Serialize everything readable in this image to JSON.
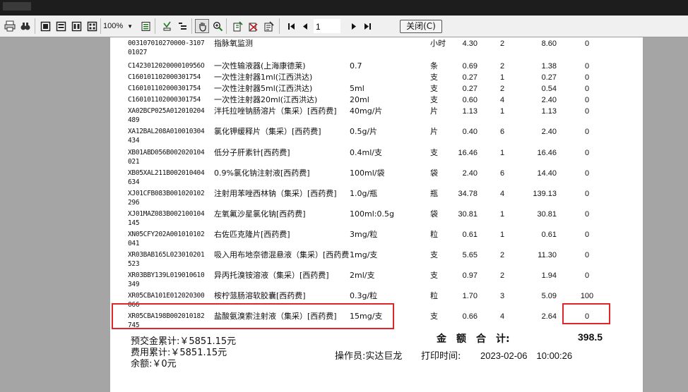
{
  "toolbar": {
    "zoom": "100%",
    "page": "1",
    "close_label": "关闭(C)"
  },
  "rows": [
    {
      "code": "003107010270000-3107",
      "code2": "01027",
      "name": "指脉氧监测",
      "spec": "",
      "unit": "小时",
      "price": "4.30",
      "qty": "2",
      "amount": "8.60",
      "last": "0"
    },
    {
      "code": "C142301202000010956O",
      "code2": "",
      "name": "一次性输液器(上海康德莱)",
      "spec": "0.7",
      "unit": "条",
      "price": "0.69",
      "qty": "2",
      "amount": "1.38",
      "last": "0"
    },
    {
      "code": "C160101102000301754",
      "code2": "",
      "name": "一次性注射器1ml(江西洪达)",
      "spec": "",
      "unit": "支",
      "price": "0.27",
      "qty": "1",
      "amount": "0.27",
      "last": "0"
    },
    {
      "code": "C160101102000301754",
      "code2": "",
      "name": "一次性注射器5ml(江西洪达)",
      "spec": "5ml",
      "unit": "支",
      "price": "0.27",
      "qty": "2",
      "amount": "0.54",
      "last": "0"
    },
    {
      "code": "C160101102000301754",
      "code2": "",
      "name": "一次性注射器20ml(江西洪达)",
      "spec": "20ml",
      "unit": "支",
      "price": "0.60",
      "qty": "4",
      "amount": "2.40",
      "last": "0"
    },
    {
      "code": "XA02BCP025A012010204",
      "code2": "489",
      "name": "泮托拉唑钠肠溶片（集采）[西药费]",
      "spec": "40mg/片",
      "unit": "片",
      "price": "1.13",
      "qty": "1",
      "amount": "1.13",
      "last": "0"
    },
    {
      "code": "XA12BAL208A010010304",
      "code2": "434",
      "name": "氯化钾缓释片（集采）[西药费]",
      "spec": "0.5g/片",
      "unit": "片",
      "price": "0.40",
      "qty": "6",
      "amount": "2.40",
      "last": "0"
    },
    {
      "code": "XB01ABD056B002020104",
      "code2": "021",
      "name": "低分子肝素针[西药费]",
      "spec": "0.4ml/支",
      "unit": "支",
      "price": "16.46",
      "qty": "1",
      "amount": "16.46",
      "last": "0"
    },
    {
      "code": "XB05XAL211B002010404",
      "code2": "634",
      "name": "0.9%氯化钠注射液[西药费]",
      "spec": "100ml/袋",
      "unit": "袋",
      "price": "2.40",
      "qty": "6",
      "amount": "14.40",
      "last": "0"
    },
    {
      "code": "XJ01CFB083B001020102",
      "code2": "296",
      "name": "注射用苯唑西林钠（集采）[西药费]",
      "spec": "1.0g/瓶",
      "unit": "瓶",
      "price": "34.78",
      "qty": "4",
      "amount": "139.13",
      "last": "0"
    },
    {
      "code": "XJ01MAZ083B002100104",
      "code2": "145",
      "name": "左氧氟沙星氯化钠[西药费]",
      "spec": "100ml:0.5g",
      "unit": "袋",
      "price": "30.81",
      "qty": "1",
      "amount": "30.81",
      "last": "0"
    },
    {
      "code": "XN05CFY202A001010102",
      "code2": "041",
      "name": "右佐匹克隆片[西药费]",
      "spec": "3mg/粒",
      "unit": "粒",
      "price": "0.61",
      "qty": "1",
      "amount": "0.61",
      "last": "0"
    },
    {
      "code": "XR03BAB165L023010201",
      "code2": "523",
      "name": "吸入用布地奈德混悬液（集采）[西药费",
      "spec": "1mg/支",
      "unit": "支",
      "price": "5.65",
      "qty": "2",
      "amount": "11.30",
      "last": "0"
    },
    {
      "code": "XR03BBY139L019010610",
      "code2": "349",
      "name": "异丙托溴铵溶液（集采）[西药费]",
      "spec": "2ml/支",
      "unit": "支",
      "price": "0.97",
      "qty": "2",
      "amount": "1.94",
      "last": "0"
    },
    {
      "code": "XR05CBA101E012020300",
      "code2": "066",
      "name": "桉柠蒎肠溶软胶囊[西药费]",
      "spec": "0.3g/粒",
      "unit": "粒",
      "price": "1.70",
      "qty": "3",
      "amount": "5.09",
      "last": "100"
    },
    {
      "code": "XR05CBA198B002010182",
      "code2": "745",
      "name": "盐酸氨溴索注射液（集采）[西药费]",
      "spec": "15mg/支",
      "unit": "支",
      "price": "0.66",
      "qty": "4",
      "amount": "2.64",
      "last": "0"
    }
  ],
  "footer": {
    "prepay": "预交金累计:￥5851.15元",
    "cost": "费用累计:￥5851.15元",
    "balance": "余额:￥0元",
    "total_label": "金　额　合　计:",
    "total_value": "398.5",
    "operator": "操作员:实达巨龙",
    "print_time_label": "打印时间:",
    "print_time": "2023-02-06　10:00:26"
  },
  "colors": {
    "highlight": "#e0262b",
    "viewer_bg": "#a5a5a5",
    "toolbar_bg": "#f0f0f0"
  }
}
